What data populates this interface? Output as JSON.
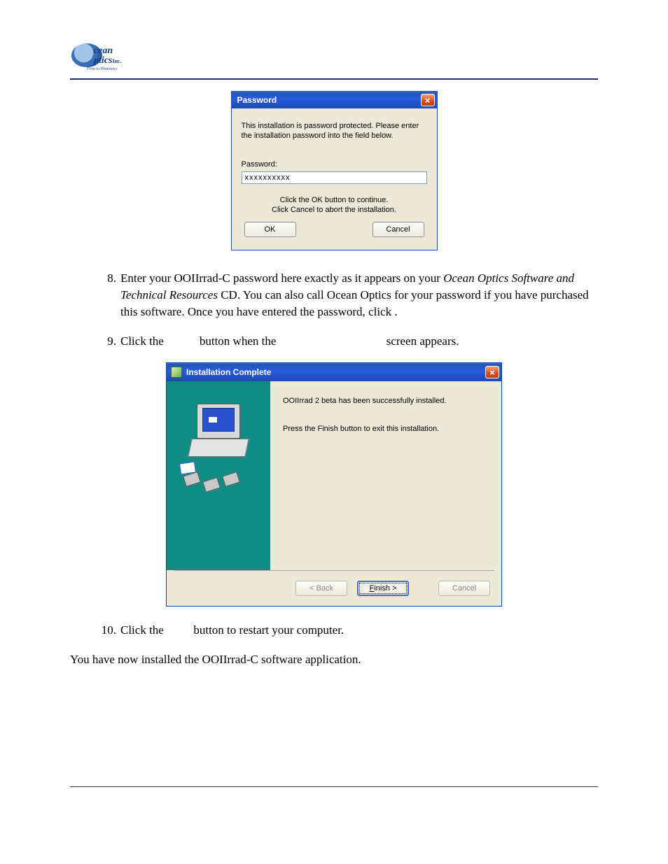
{
  "logo": {
    "line1": "cean",
    "line2": "ptics",
    "suffix": "Inc.",
    "tagline": "First in Photonics"
  },
  "password_dialog": {
    "title": "Password",
    "message": "This installation is password protected. Please enter the installation password into the field below.",
    "label": "Password:",
    "value": "xxxxxxxxxx",
    "hint1": "Click the OK button to continue.",
    "hint2": "Click Cancel to abort the installation.",
    "ok": "OK",
    "cancel": "Cancel"
  },
  "step8": {
    "num": "8.",
    "pre": "Enter your OOIIrrad-C password here exactly as it appears on your ",
    "em": "Ocean Optics Software and Technical Resources",
    "post": " CD. You can also call Ocean Optics for your password if you have purchased this software. Once you have entered the password, click       ."
  },
  "step9": {
    "num": "9.",
    "a": "Click the ",
    "b": " button when the ",
    "c": " screen appears."
  },
  "install_dialog": {
    "title": "Installation Complete",
    "line1": "OOIIrrad 2 beta has been successfully installed.",
    "line2": "Press the Finish button to exit this installation.",
    "back": "< Back",
    "finish_pre": "F",
    "finish_post": "inish >",
    "cancel": "Cancel"
  },
  "step10": {
    "num": "10.",
    "a": "Click the ",
    "b": " button to restart your computer."
  },
  "closing": "You have now installed the OOIIrrad-C software application."
}
